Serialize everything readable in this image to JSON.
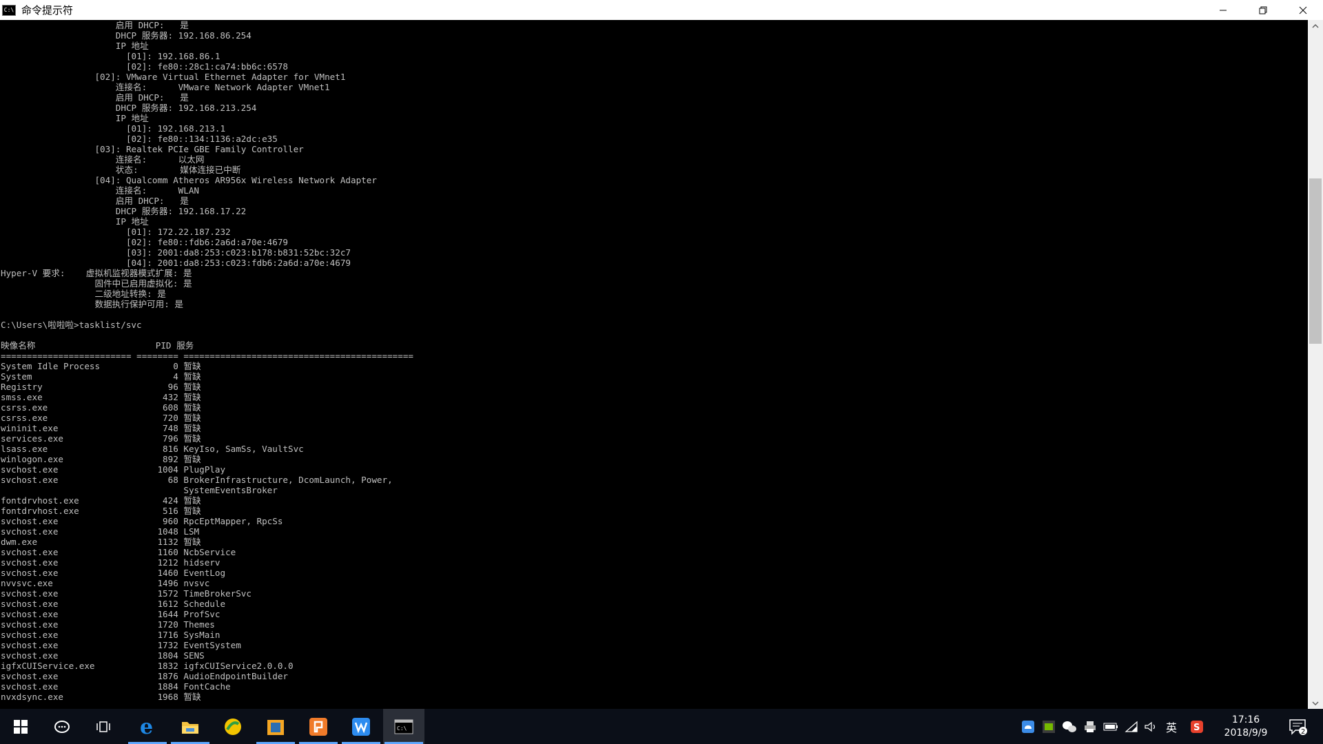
{
  "window": {
    "title": "命令提示符",
    "icon_text": "C:\\",
    "minimize_icon": "minimize-icon",
    "maximize_icon": "restore-icon",
    "close_icon": "close-icon"
  },
  "console": {
    "lines": [
      "                      启用 DHCP:   是",
      "                      DHCP 服务器: 192.168.86.254",
      "                      IP 地址",
      "                        [01]: 192.168.86.1",
      "                        [02]: fe80::28c1:ca74:bb6c:6578",
      "                  [02]: VMware Virtual Ethernet Adapter for VMnet1",
      "                      连接名:      VMware Network Adapter VMnet1",
      "                      启用 DHCP:   是",
      "                      DHCP 服务器: 192.168.213.254",
      "                      IP 地址",
      "                        [01]: 192.168.213.1",
      "                        [02]: fe80::134:1136:a2dc:e35",
      "                  [03]: Realtek PCIe GBE Family Controller",
      "                      连接名:      以太网",
      "                      状态:        媒体连接已中断",
      "                  [04]: Qualcomm Atheros AR956x Wireless Network Adapter",
      "                      连接名:      WLAN",
      "                      启用 DHCP:   是",
      "                      DHCP 服务器: 192.168.17.22",
      "                      IP 地址",
      "                        [01]: 172.22.187.232",
      "                        [02]: fe80::fdb6:2a6d:a70e:4679",
      "                        [03]: 2001:da8:253:c023:b178:b831:52bc:32c7",
      "                        [04]: 2001:da8:253:c023:fdb6:2a6d:a70e:4679",
      "Hyper-V 要求:    虚拟机监视器模式扩展: 是",
      "                  固件中已启用虚拟化: 是",
      "                  二级地址转换: 是",
      "                  数据执行保护可用: 是",
      "",
      "C:\\Users\\啦啦啦>tasklist/svc",
      "",
      "映像名称                       PID 服务",
      "========================= ======== ============================================",
      "System Idle Process              0 暂缺",
      "System                           4 暂缺",
      "Registry                        96 暂缺",
      "smss.exe                       432 暂缺",
      "csrss.exe                      608 暂缺",
      "csrss.exe                      720 暂缺",
      "wininit.exe                    748 暂缺",
      "services.exe                   796 暂缺",
      "lsass.exe                      816 KeyIso, SamSs, VaultSvc",
      "winlogon.exe                   892 暂缺",
      "svchost.exe                   1004 PlugPlay",
      "svchost.exe                     68 BrokerInfrastructure, DcomLaunch, Power,",
      "                                   SystemEventsBroker",
      "fontdrvhost.exe                424 暂缺",
      "fontdrvhost.exe                516 暂缺",
      "svchost.exe                    960 RpcEptMapper, RpcSs",
      "svchost.exe                   1048 LSM",
      "dwm.exe                       1132 暂缺",
      "svchost.exe                   1160 NcbService",
      "svchost.exe                   1212 hidserv",
      "svchost.exe                   1460 EventLog",
      "nvvsvc.exe                    1496 nvsvc",
      "svchost.exe                   1572 TimeBrokerSvc",
      "svchost.exe                   1612 Schedule",
      "svchost.exe                   1644 ProfSvc",
      "svchost.exe                   1720 Themes",
      "svchost.exe                   1716 SysMain",
      "svchost.exe                   1732 EventSystem",
      "svchost.exe                   1804 SENS",
      "igfxCUIService.exe            1832 igfxCUIService2.0.0.0",
      "svchost.exe                   1876 AudioEndpointBuilder",
      "svchost.exe                   1884 FontCache",
      "nvxdsync.exe                  1968 暂缺"
    ]
  },
  "scrollbar": {
    "up_icon": "scroll-up-arrow-icon",
    "down_icon": "scroll-down-arrow-icon"
  },
  "taskbar": {
    "pinned": [
      {
        "name": "start-button",
        "icon": "windows-logo-icon"
      },
      {
        "name": "cortana-button",
        "icon": "cortana-icon"
      },
      {
        "name": "task-view-button",
        "icon": "task-view-icon"
      },
      {
        "name": "edge-button",
        "icon": "edge-icon",
        "running": true
      },
      {
        "name": "file-explorer-button",
        "icon": "folder-icon",
        "running": true
      },
      {
        "name": "app-360-button",
        "icon": "360-icon",
        "running": false
      },
      {
        "name": "app-box-button",
        "icon": "box-app-icon",
        "running": true
      },
      {
        "name": "powerpoint-button",
        "icon": "presentation-icon",
        "running": true
      },
      {
        "name": "wps-button",
        "icon": "wps-writer-icon",
        "running": true
      },
      {
        "name": "cmd-button",
        "icon": "terminal-icon",
        "running": true,
        "active": true
      }
    ],
    "tray": {
      "icons": [
        "cloud-sync-icon",
        "nvidia-icon",
        "wechat-icon",
        "printer-icon",
        "battery-icon",
        "wifi-icon",
        "volume-icon",
        "ime-icon",
        "sogou-icon"
      ],
      "ime_label": "英",
      "time": "17:16",
      "date": "2018/9/9",
      "notification_count": "2"
    }
  },
  "colors": {
    "console_bg": "#000000",
    "console_fg": "#c0c0c0",
    "taskbar_bg": "#0b0f18",
    "accent": "#5fa8ff"
  }
}
